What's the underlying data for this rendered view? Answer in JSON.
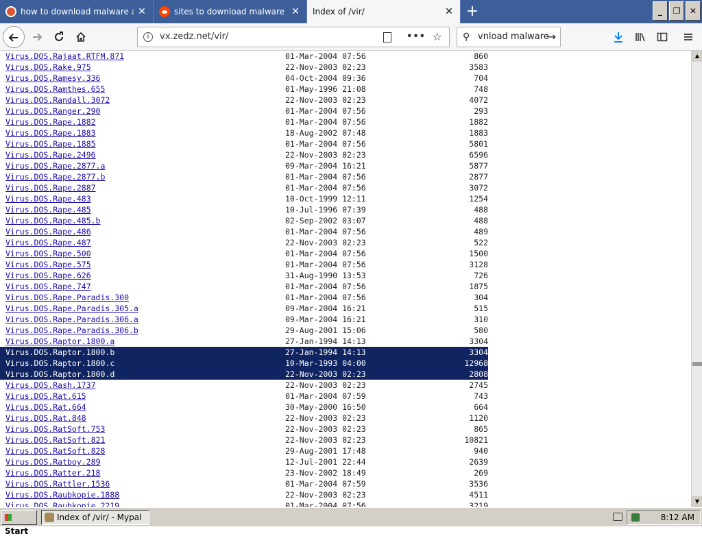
{
  "browser": {
    "tabs": [
      {
        "title": "how to download malware at DuckDuckGo",
        "icon": "duckduckgo-icon",
        "active": false
      },
      {
        "title": "sites to download malware : Malware",
        "icon": "reddit-icon",
        "active": false
      },
      {
        "title": "Index of /vir/",
        "icon": "",
        "active": true
      }
    ],
    "new_tab": "+",
    "window_buttons": {
      "minimize": "_",
      "restore": "❐",
      "close": "✕"
    }
  },
  "navbar": {
    "url": "vx.zedz.net/vir/",
    "page_actions": "•••",
    "search_query": "vnload malware"
  },
  "listing": [
    {
      "name": "Virus.DOS.Rajaat.RTFM.871",
      "date": "01-Mar-2004 07:56",
      "size": "860"
    },
    {
      "name": "Virus.DOS.Rake.975",
      "date": "22-Nov-2003 02:23",
      "size": "3583"
    },
    {
      "name": "Virus.DOS.Ramesy.336",
      "date": "04-Oct-2004 09:36",
      "size": "704"
    },
    {
      "name": "Virus.DOS.Ramthes.655",
      "date": "01-May-1996 21:08",
      "size": "748"
    },
    {
      "name": "Virus.DOS.Randall.3072",
      "date": "22-Nov-2003 02:23",
      "size": "4072"
    },
    {
      "name": "Virus.DOS.Ranger.290",
      "date": "01-Mar-2004 07:56",
      "size": "293"
    },
    {
      "name": "Virus.DOS.Rape.1882",
      "date": "01-Mar-2004 07:56",
      "size": "1882"
    },
    {
      "name": "Virus.DOS.Rape.1883",
      "date": "18-Aug-2002 07:48",
      "size": "1883"
    },
    {
      "name": "Virus.DOS.Rape.1885",
      "date": "01-Mar-2004 07:56",
      "size": "5801"
    },
    {
      "name": "Virus.DOS.Rape.2496",
      "date": "22-Nov-2003 02:23",
      "size": "6596"
    },
    {
      "name": "Virus.DOS.Rape.2877.a",
      "date": "09-Mar-2004 16:21",
      "size": "5877"
    },
    {
      "name": "Virus.DOS.Rape.2877.b",
      "date": "01-Mar-2004 07:56",
      "size": "2877"
    },
    {
      "name": "Virus.DOS.Rape.2887",
      "date": "01-Mar-2004 07:56",
      "size": "3072"
    },
    {
      "name": "Virus.DOS.Rape.483",
      "date": "10-Oct-1999 12:11",
      "size": "1254"
    },
    {
      "name": "Virus.DOS.Rape.485",
      "date": "10-Jul-1996 07:39",
      "size": "488"
    },
    {
      "name": "Virus.DOS.Rape.485.b",
      "date": "02-Sep-2002 03:07",
      "size": "488"
    },
    {
      "name": "Virus.DOS.Rape.486",
      "date": "01-Mar-2004 07:56",
      "size": "489"
    },
    {
      "name": "Virus.DOS.Rape.487",
      "date": "22-Nov-2003 02:23",
      "size": "522"
    },
    {
      "name": "Virus.DOS.Rape.500",
      "date": "01-Mar-2004 07:56",
      "size": "1500"
    },
    {
      "name": "Virus.DOS.Rape.575",
      "date": "01-Mar-2004 07:56",
      "size": "3128"
    },
    {
      "name": "Virus.DOS.Rape.626",
      "date": "31-Aug-1990 13:53",
      "size": "726"
    },
    {
      "name": "Virus.DOS.Rape.747",
      "date": "01-Mar-2004 07:56",
      "size": "1875"
    },
    {
      "name": "Virus.DOS.Rape.Paradis.300",
      "date": "01-Mar-2004 07:56",
      "size": "304"
    },
    {
      "name": "Virus.DOS.Rape.Paradis.305.a",
      "date": "09-Mar-2004 16:21",
      "size": "515"
    },
    {
      "name": "Virus.DOS.Rape.Paradis.306.a",
      "date": "09-Mar-2004 16:21",
      "size": "310"
    },
    {
      "name": "Virus.DOS.Rape.Paradis.306.b",
      "date": "29-Aug-2001 15:06",
      "size": "580"
    },
    {
      "name": "Virus.DOS.Raptor.1800.a",
      "date": "27-Jan-1994 14:13",
      "size": "3304"
    },
    {
      "name": "Virus.DOS.Raptor.1800.b",
      "date": "27-Jan-1994 14:13",
      "size": "3304",
      "selected": true
    },
    {
      "name": "Virus.DOS.Raptor.1800.c",
      "date": "10-Mar-1993 04:00",
      "size": "12968",
      "selected": true
    },
    {
      "name": "Virus.DOS.Raptor.1800.d",
      "date": "22-Nov-2003 02:23",
      "size": "2808",
      "selected": true
    },
    {
      "name": "Virus.DOS.Rash.1737",
      "date": "22-Nov-2003 02:23",
      "size": "2745"
    },
    {
      "name": "Virus.DOS.Rat.615",
      "date": "01-Mar-2004 07:59",
      "size": "743"
    },
    {
      "name": "Virus.DOS.Rat.664",
      "date": "30-May-2000 16:50",
      "size": "664"
    },
    {
      "name": "Virus.DOS.Rat.848",
      "date": "22-Nov-2003 02:23",
      "size": "1120"
    },
    {
      "name": "Virus.DOS.RatSoft.753",
      "date": "22-Nov-2003 02:23",
      "size": "865"
    },
    {
      "name": "Virus.DOS.RatSoft.821",
      "date": "22-Nov-2003 02:23",
      "size": "10821"
    },
    {
      "name": "Virus.DOS.RatSoft.828",
      "date": "29-Aug-2001 17:48",
      "size": "940"
    },
    {
      "name": "Virus.DOS.Ratboy.289",
      "date": "12-Jul-2001 22:44",
      "size": "2639"
    },
    {
      "name": "Virus.DOS.Ratter.218",
      "date": "23-Nov-2002 18:49",
      "size": "269"
    },
    {
      "name": "Virus.DOS.Rattler.1536",
      "date": "01-Mar-2004 07:59",
      "size": "3536"
    },
    {
      "name": "Virus.DOS.Raubkopie.1888",
      "date": "22-Nov-2003 02:23",
      "size": "4511"
    },
    {
      "name": "Virus.DOS.Raubkopie.2219",
      "date": "01-Mar-2004 07:56",
      "size": "3219"
    }
  ],
  "taskbar": {
    "start_label": "Start",
    "active_window": "Index of /vir/ - Mypal",
    "clock": "8:12 AM"
  },
  "colors": {
    "tabbar_bg": "#3d5f99",
    "selection_bg": "#0f2460",
    "link": "#1a0dab"
  }
}
